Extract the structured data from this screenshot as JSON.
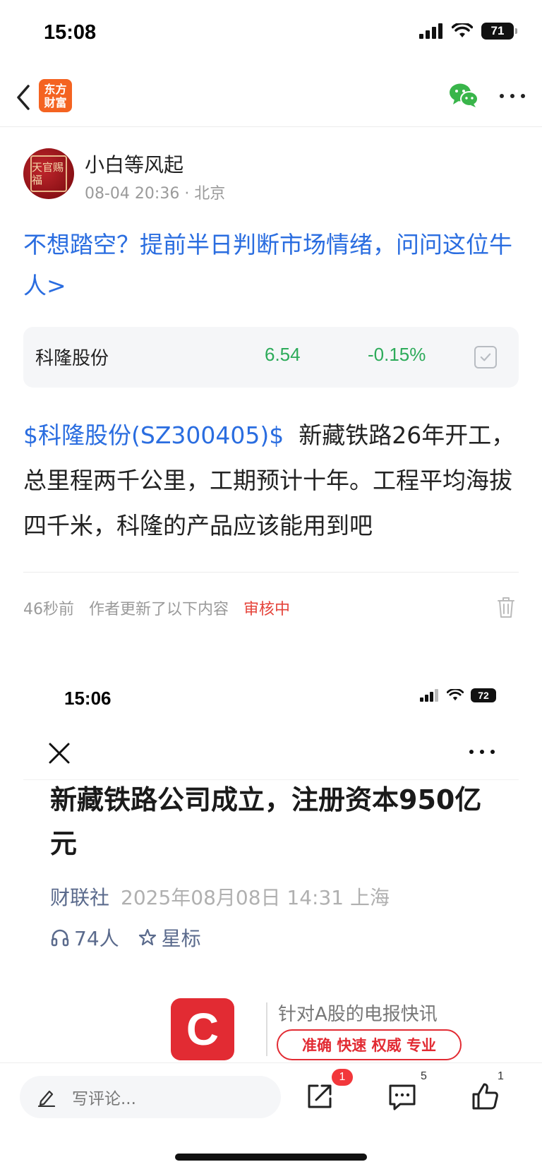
{
  "status_bar": {
    "time": "15:08",
    "battery": "71"
  },
  "nav": {
    "logo_line1": "东方",
    "logo_line2": "财富"
  },
  "author": {
    "name": "小白等风起",
    "meta": "08-04 20:36 · 北京",
    "avatar_text": "天官赐福"
  },
  "promo_text": "不想踏空？提前半日判断市场情绪，问问这位牛人>",
  "stock": {
    "name": "科隆股份",
    "price": "6.54",
    "change": "-0.15%"
  },
  "post": {
    "stock_link": "$科隆股份(SZ300405)$",
    "text": "新藏铁路26年开工，总里程两千公里，工期预计十年。工程平均海拔四千米，科隆的产品应该能用到吧"
  },
  "update": {
    "time": "46秒前",
    "text": "作者更新了以下内容",
    "status": "审核中"
  },
  "embed": {
    "time": "15:06",
    "battery": "72",
    "headline": "新藏铁路公司成立，注册资本950亿元",
    "source": "财联社",
    "datetime": "2025年08月08日 14:31 上海",
    "listeners": "74人",
    "star_label": "星标",
    "banner_logo": "C",
    "banner_slogan": "针对A股的电报快讯",
    "banner_tags": "准确 快速 权威 专业"
  },
  "bottom_bar": {
    "comment_placeholder": "写评论...",
    "share_badge": "1",
    "comment_count": "5",
    "like_count": "1"
  },
  "colors": {
    "link": "#2a6de0",
    "stock_green": "#2dab5a",
    "review_red": "#e5443b",
    "brand_orange": "#f46321"
  }
}
